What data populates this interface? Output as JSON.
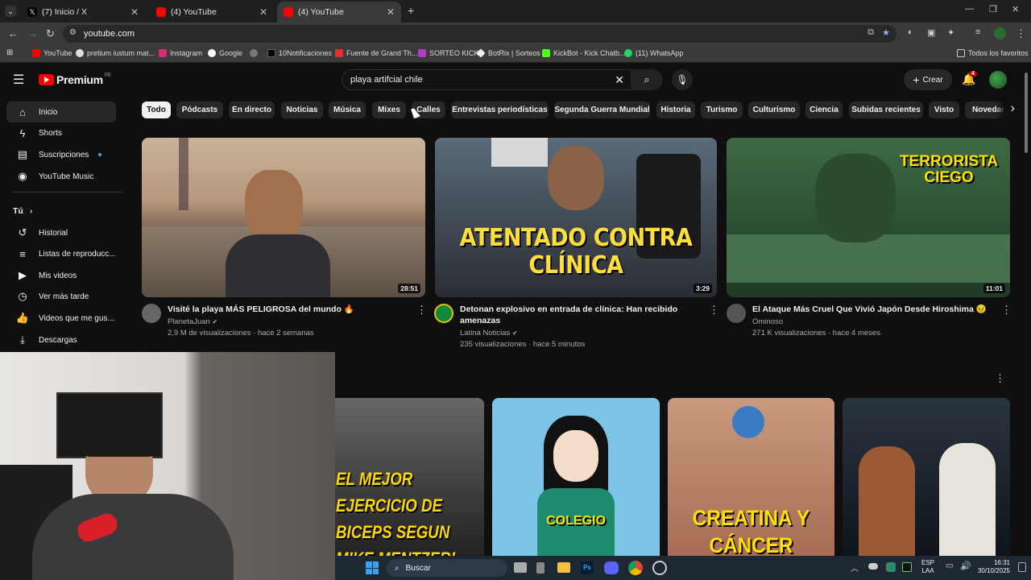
{
  "browser": {
    "tabs": [
      {
        "label": "(7) Inicio / X",
        "icon": "x-icon"
      },
      {
        "label": "(4) YouTube",
        "icon": "youtube-icon"
      },
      {
        "label": "(4) YouTube",
        "icon": "youtube-icon"
      }
    ],
    "url": "youtube.com",
    "bookmarks": [
      "YouTube",
      "pretium iustum mat...",
      "Instagram",
      "Google",
      "10Notificaciones",
      "Fuente de Grand Th...",
      "SORTEO KICK",
      "BotRix | Sorteos",
      "KickBot - Kick Chatb...",
      "(11) WhatsApp"
    ],
    "all_bookmarks": "Todos los favoritos"
  },
  "youtube": {
    "logo": "Premium",
    "region": "PE",
    "search_value": "playa artifcial chile",
    "create_label": "Crear",
    "notif_count": "4"
  },
  "sidebar": {
    "items": [
      {
        "label": "Inicio",
        "icon": "home-icon"
      },
      {
        "label": "Shorts",
        "icon": "shorts-icon"
      },
      {
        "label": "Suscripciones",
        "icon": "subscriptions-icon"
      },
      {
        "label": "YouTube Music",
        "icon": "music-icon"
      }
    ],
    "you_label": "Tú",
    "you_items": [
      {
        "label": "Historial",
        "icon": "history-icon"
      },
      {
        "label": "Listas de reproducc...",
        "icon": "playlist-icon"
      },
      {
        "label": "Mis videos",
        "icon": "video-icon"
      },
      {
        "label": "Ver más tarde",
        "icon": "clock-icon"
      },
      {
        "label": "Videos que me gus...",
        "icon": "like-icon"
      },
      {
        "label": "Descargas",
        "icon": "download-icon"
      }
    ]
  },
  "chips": [
    "Todo",
    "Pódcasts",
    "En directo",
    "Noticias",
    "Música",
    "Mixes",
    "Calles",
    "Entrevistas periodísticas",
    "Segunda Guerra Mundial",
    "Historia",
    "Turismo",
    "Culturismo",
    "Ciencia",
    "Subidas recientes",
    "Visto",
    "Novedad"
  ],
  "videos": [
    {
      "title": "Visité la playa MÁS PELIGROSA del mundo 🔥",
      "channel": "PlanetaJuan",
      "meta": "2,9 M de visualizaciones · hace 2 semanas",
      "duration": "28:51"
    },
    {
      "title": "Detonan explosivo en entrada de clínica: Han recibido amenazas",
      "channel": "Latina Noticias",
      "meta": "235 visualizaciones · hace 5 minutos",
      "duration": "3:29",
      "overlay": "ATENTADO CONTRA CLÍNICA"
    },
    {
      "title": "El Ataque Más Cruel Que Vivió Japón Desde Hiroshima 😣",
      "channel": "Ominoso",
      "meta": "271 K visualizaciones · hace 4 meses",
      "duration": "11:01",
      "overlay": "TERRORISTA CIEGO"
    }
  ],
  "shorts": [
    {
      "overlay": "EL MEJOR EJERCICIO DE BICEPS SEGUN MIKE MENTZER!"
    },
    {
      "overlay": "COLEGIO"
    },
    {
      "overlay": "CREATINA Y CÁNCER"
    },
    {
      "overlay": ""
    }
  ],
  "taskbar": {
    "search": "Buscar",
    "lang1": "ESP",
    "lang2": "LAA",
    "time": "16:31",
    "date": "30/10/2025"
  }
}
